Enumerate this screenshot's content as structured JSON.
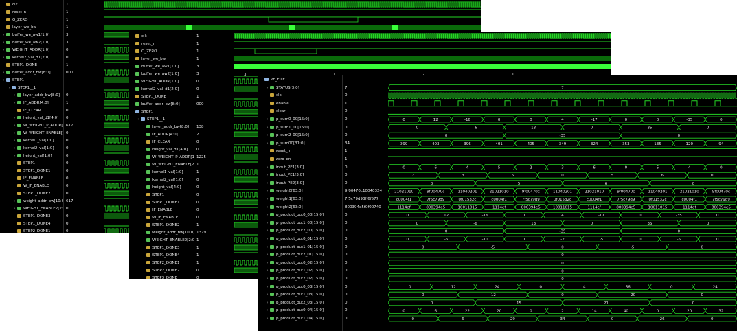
{
  "windows": [
    {
      "id": "w1",
      "rows": [
        {
          "name": "clk",
          "value": "1",
          "kind": "bit",
          "indent": 0
        },
        {
          "name": "reset_n",
          "value": "1",
          "kind": "bit",
          "indent": 0
        },
        {
          "name": "O_ZERO",
          "value": "1",
          "kind": "bit",
          "indent": 0
        },
        {
          "name": "layer_we_bw",
          "value": "1",
          "kind": "bit",
          "indent": 0
        },
        {
          "name": "buffer_we_aw1[1:0]",
          "value": "3",
          "kind": "bus",
          "indent": 0
        },
        {
          "name": "buffer_we_aw2[1:0]",
          "value": "3",
          "kind": "bus",
          "indent": 0
        },
        {
          "name": "WEIGHT_ADDR[1:0]",
          "value": "0",
          "kind": "bus",
          "indent": 0
        },
        {
          "name": "kernel2_val_d1[2:0]",
          "value": "0",
          "kind": "bus",
          "indent": 0
        },
        {
          "name": "STEP1_DONE",
          "value": "1",
          "kind": "bit",
          "indent": 0
        },
        {
          "name": "buffer_addr_bw[8:0]",
          "value": "000",
          "kind": "bus",
          "indent": 0
        },
        {
          "name": "STEP1",
          "value": "",
          "kind": "grp",
          "indent": 0
        },
        {
          "name": "STEP1__1",
          "value": "",
          "kind": "grp",
          "indent": 1
        },
        {
          "name": "layer_addr_bw[8:0]",
          "value": "0",
          "kind": "bus",
          "indent": 2
        },
        {
          "name": "IF_ADDR[4:0]",
          "value": "1",
          "kind": "bus",
          "indent": 2
        },
        {
          "name": "IF_CLEAR",
          "value": "0",
          "kind": "bit",
          "indent": 2
        },
        {
          "name": "height_val_d1[4:0]",
          "value": "0",
          "kind": "bus",
          "indent": 2
        },
        {
          "name": "W_WEIGHT_P_ADDR[15:0]",
          "value": "617",
          "kind": "bus",
          "indent": 2
        },
        {
          "name": "W_WEIGHT_ENABLE[2:0]",
          "value": "0",
          "kind": "bus",
          "indent": 2
        },
        {
          "name": "kernel1_val[1:0]",
          "value": "0",
          "kind": "bus",
          "indent": 2
        },
        {
          "name": "kernel2_val[1:0]",
          "value": "0",
          "kind": "bus",
          "indent": 2
        },
        {
          "name": "height_val[1:0]",
          "value": "0",
          "kind": "bus",
          "indent": 2
        },
        {
          "name": "STEP1",
          "value": "0",
          "kind": "bit",
          "indent": 2
        },
        {
          "name": "STEP1_DONE1",
          "value": "0",
          "kind": "bit",
          "indent": 2
        },
        {
          "name": "IF_ENABLE",
          "value": "0",
          "kind": "bit",
          "indent": 2
        },
        {
          "name": "W_IF_ENABLE",
          "value": "0",
          "kind": "bit",
          "indent": 2
        },
        {
          "name": "STEP1_DONE2",
          "value": "0",
          "kind": "bit",
          "indent": 2
        },
        {
          "name": "weight_addr_bw[10:0]",
          "value": "617",
          "kind": "bus",
          "indent": 2
        },
        {
          "name": "WEIGHT_ENABLE2[2:0]",
          "value": "0",
          "kind": "bus",
          "indent": 2
        },
        {
          "name": "STEP1_DONE3",
          "value": "0",
          "kind": "bit",
          "indent": 2
        },
        {
          "name": "STEP1_DONE4",
          "value": "0",
          "kind": "bit",
          "indent": 2
        },
        {
          "name": "STEP2_DONE1",
          "value": "0",
          "kind": "bit",
          "indent": 2
        }
      ]
    },
    {
      "id": "w2",
      "rows": [
        {
          "name": "clk",
          "value": "1",
          "kind": "bit",
          "indent": 0
        },
        {
          "name": "reset_n",
          "value": "1",
          "kind": "bit",
          "indent": 0
        },
        {
          "name": "O_ZERO",
          "value": "1",
          "kind": "bit",
          "indent": 0
        },
        {
          "name": "layer_we_bw",
          "value": "1",
          "kind": "bit",
          "indent": 0
        },
        {
          "name": "buffer_we_aw1[1:0]",
          "value": "3",
          "kind": "bus",
          "indent": 0
        },
        {
          "name": "buffer_we_aw2[1:0]",
          "value": "3",
          "kind": "bus",
          "indent": 0
        },
        {
          "name": "WEIGHT_ADDR[1:0]",
          "value": "0",
          "kind": "bus",
          "indent": 0
        },
        {
          "name": "kernel2_val_d1[2:0]",
          "value": "0",
          "kind": "bus",
          "indent": 0
        },
        {
          "name": "STEP1_DONE",
          "value": "1",
          "kind": "bit",
          "indent": 0
        },
        {
          "name": "buffer_addr_bw[8:0]",
          "value": "000",
          "kind": "bus",
          "indent": 0
        },
        {
          "name": "STEP1",
          "value": "",
          "kind": "grp",
          "indent": 0
        },
        {
          "name": "STEP1__1",
          "value": "",
          "kind": "grp",
          "indent": 1
        },
        {
          "name": "layer_addr_bw[8:0]",
          "value": "138",
          "kind": "bus",
          "indent": 2
        },
        {
          "name": "IF_ADDR[4:0]",
          "value": "2",
          "kind": "bus",
          "indent": 2
        },
        {
          "name": "IF_CLEAR",
          "value": "0",
          "kind": "bit",
          "indent": 2
        },
        {
          "name": "height_val_d1[4:0]",
          "value": "0",
          "kind": "bus",
          "indent": 2
        },
        {
          "name": "W_WEIGHT_P_ADDR[15:0]",
          "value": "1225",
          "kind": "bus",
          "indent": 2
        },
        {
          "name": "W_WEIGHT_ENABLE[2:0]",
          "value": "1",
          "kind": "bus",
          "indent": 2
        },
        {
          "name": "kernel1_val[1:0]",
          "value": "1",
          "kind": "bus",
          "indent": 2
        },
        {
          "name": "kernel2_val[1:0]",
          "value": "0",
          "kind": "bus",
          "indent": 2
        },
        {
          "name": "height_val[4:0]",
          "value": "0",
          "kind": "bus",
          "indent": 2
        },
        {
          "name": "STEP1",
          "value": "0",
          "kind": "bit",
          "indent": 2
        },
        {
          "name": "STEP1_DONE1",
          "value": "0",
          "kind": "bit",
          "indent": 2
        },
        {
          "name": "IF_ENABLE",
          "value": "0",
          "kind": "bit",
          "indent": 2
        },
        {
          "name": "W_IF_ENABLE",
          "value": "0",
          "kind": "bit",
          "indent": 2
        },
        {
          "name": "STEP1_DONE2",
          "value": "1",
          "kind": "bit",
          "indent": 2
        },
        {
          "name": "weight_addr_bw[10:0]",
          "value": "1379",
          "kind": "bus",
          "indent": 2
        },
        {
          "name": "WEIGHT_ENABLE2[2:0]",
          "value": "1",
          "kind": "bus",
          "indent": 2
        },
        {
          "name": "STEP1_DONE3",
          "value": "1",
          "kind": "bit",
          "indent": 2
        },
        {
          "name": "STEP1_DONE4",
          "value": "1",
          "kind": "bit",
          "indent": 2
        },
        {
          "name": "STEP2_DONE1",
          "value": "1",
          "kind": "bit",
          "indent": 2
        },
        {
          "name": "STEP2_DONE2",
          "value": "0",
          "kind": "bit",
          "indent": 2
        },
        {
          "name": "STEP3_DONE",
          "value": "0",
          "kind": "bit",
          "indent": 2
        }
      ]
    },
    {
      "id": "w3",
      "rows": [
        {
          "name": "PE_FILE",
          "value": "",
          "kind": "grp",
          "indent": 0
        },
        {
          "name": "STATUS[3:0]",
          "value": "7",
          "kind": "bus",
          "indent": 1
        },
        {
          "name": "clk",
          "value": "0",
          "kind": "bit",
          "indent": 1
        },
        {
          "name": "enable",
          "value": "1",
          "kind": "bit",
          "indent": 1
        },
        {
          "name": "clear",
          "value": "0",
          "kind": "bit",
          "indent": 1
        },
        {
          "name": "p_sum0_00[15:0]",
          "value": "0",
          "kind": "bus",
          "indent": 1
        },
        {
          "name": "p_sum1_00[15:0]",
          "value": "0",
          "kind": "bus",
          "indent": 1
        },
        {
          "name": "p_sum2_00[15:0]",
          "value": "0",
          "kind": "bus",
          "indent": 1
        },
        {
          "name": "p_sum00[31:0]",
          "value": "34",
          "kind": "bus",
          "indent": 1
        },
        {
          "name": "reset_n",
          "value": "1",
          "kind": "bit",
          "indent": 1
        },
        {
          "name": "zero_en",
          "value": "1",
          "kind": "bit",
          "indent": 1
        },
        {
          "name": "input_PE1[3:0]",
          "value": "0",
          "kind": "bus",
          "indent": 1
        },
        {
          "name": "input_PE1[3:0]",
          "value": "0",
          "kind": "bus",
          "indent": 1
        },
        {
          "name": "input_PE2[3:0]",
          "value": "0",
          "kind": "bus",
          "indent": 1
        },
        {
          "name": "weight0[63:0]",
          "value": "9f00470c10040324",
          "kind": "bus",
          "indent": 1
        },
        {
          "name": "weight1[63:0]",
          "value": "7f5c79d93ff6f577",
          "kind": "bus",
          "indent": 1
        },
        {
          "name": "weight2[63:0]",
          "value": "800394e5f0f00740",
          "kind": "bus",
          "indent": 1
        },
        {
          "name": "p_product_out0_00[15:0]",
          "value": "0",
          "kind": "bus",
          "indent": 1
        },
        {
          "name": "p_product_out1_00[15:0]",
          "value": "0",
          "kind": "bus",
          "indent": 1
        },
        {
          "name": "p_product_out2_00[15:0]",
          "value": "0",
          "kind": "bus",
          "indent": 1
        },
        {
          "name": "p_product_out0_01[15:0]",
          "value": "0",
          "kind": "bus",
          "indent": 1
        },
        {
          "name": "p_product_out1_01[15:0]",
          "value": "0",
          "kind": "bus",
          "indent": 1
        },
        {
          "name": "p_product_out2_01[15:0]",
          "value": "0",
          "kind": "bus",
          "indent": 1
        },
        {
          "name": "p_product_out0_02[15:0]",
          "value": "0",
          "kind": "bus",
          "indent": 1
        },
        {
          "name": "p_product_out1_02[15:0]",
          "value": "0",
          "kind": "bus",
          "indent": 1
        },
        {
          "name": "p_product_out2_02[15:0]",
          "value": "0",
          "kind": "bus",
          "indent": 1
        },
        {
          "name": "p_product_out0_03[15:0]",
          "value": "0",
          "kind": "bus",
          "indent": 1
        },
        {
          "name": "p_product_out1_03[15:0]",
          "value": "0",
          "kind": "bus",
          "indent": 1
        },
        {
          "name": "p_product_out2_03[15:0]",
          "value": "0",
          "kind": "bus",
          "indent": 1
        },
        {
          "name": "p_product_out0_04[15:0]",
          "value": "0",
          "kind": "bus",
          "indent": 1
        },
        {
          "name": "p_product_out1_04[15:0]",
          "value": "0",
          "kind": "bus",
          "indent": 1
        }
      ]
    }
  ],
  "w1_wave_labels": [
    "1",
    "2",
    "1"
  ],
  "w2_wave_labels": [
    "3",
    "1",
    "2",
    "1"
  ],
  "w3_wave": {
    "status_label": "7",
    "psum0": [
      "0",
      "12",
      "-16",
      "0",
      "0",
      "4",
      "-17",
      "0",
      "0",
      "-35",
      "0"
    ],
    "psum1": [
      "0",
      "-6",
      "13",
      "0",
      "35",
      "0"
    ],
    "psum2": [
      "0",
      "-35",
      "0"
    ],
    "psum00": [
      "399",
      "403",
      "396",
      "401",
      "405",
      "349",
      "324",
      "353",
      "135",
      "120",
      "94"
    ],
    "input1": [
      "0",
      "6",
      "4",
      "5",
      "2",
      "3",
      "6",
      "0",
      "5",
      "4",
      "0"
    ],
    "input2": [
      "2",
      "3",
      "6",
      "0",
      "5",
      "6",
      "0"
    ],
    "input3": [
      "0",
      "5",
      "6",
      "0"
    ],
    "weight0": [
      "21021010",
      "9f00470c",
      "11040201",
      "21021010",
      "9f00470c",
      "11040201",
      "21021010",
      "9f00470c",
      "11040201",
      "21021010",
      "9f00470c"
    ],
    "weight1": [
      "c0004f1",
      "7f5c79d9",
      "0f01532c",
      "c0004f1",
      "7f5c79d9",
      "0f01532c",
      "c0004f1",
      "7f5c79d9",
      "0f01532c",
      "c0004f1",
      "7f5c79d9"
    ],
    "weight2": [
      "1114ef",
      "800394e5",
      "10011015",
      "1114ef",
      "800394e5",
      "10011015",
      "1114ef",
      "800394e5",
      "10011015",
      "1114ef",
      "800394e5"
    ],
    "prod0_00": [
      "0",
      "12",
      "-16",
      "0",
      "4",
      "-17",
      "0",
      "-35",
      "0"
    ],
    "prod1_00": [
      "0",
      "-6",
      "13",
      "0",
      "35",
      "0"
    ],
    "prod2_00": [
      "0",
      "-35",
      "0"
    ],
    "prod0_01": [
      "0",
      "-6",
      "-10",
      "0",
      "-2",
      "-5",
      "0",
      "-5",
      "0"
    ],
    "prod1_01": [
      "0",
      "-5",
      "0",
      "-5",
      "0"
    ],
    "prod2_01": [
      "0"
    ],
    "prod0_02": [
      "0"
    ],
    "prod1_02": [
      "0"
    ],
    "prod2_02": [
      "0"
    ],
    "prod0_03": [
      "0",
      "12",
      "24",
      "0",
      "4",
      "56",
      "0",
      "24"
    ],
    "prod1_03": [
      "0",
      "-12",
      "0",
      "-20",
      "0"
    ],
    "prod2_03": [
      "0",
      "15",
      "21",
      "0"
    ],
    "prod0_04": [
      "0",
      "6",
      "22",
      "20",
      "0",
      "2",
      "14",
      "40",
      "0",
      "20",
      "32"
    ],
    "prod1_04": [
      "0",
      "6",
      "29",
      "34",
      "0",
      "26",
      "0"
    ]
  },
  "colors": {
    "wave": "#25d625",
    "bright": "#39ff39",
    "bus_fill": "#0c5a0c",
    "bg": "#000000"
  }
}
